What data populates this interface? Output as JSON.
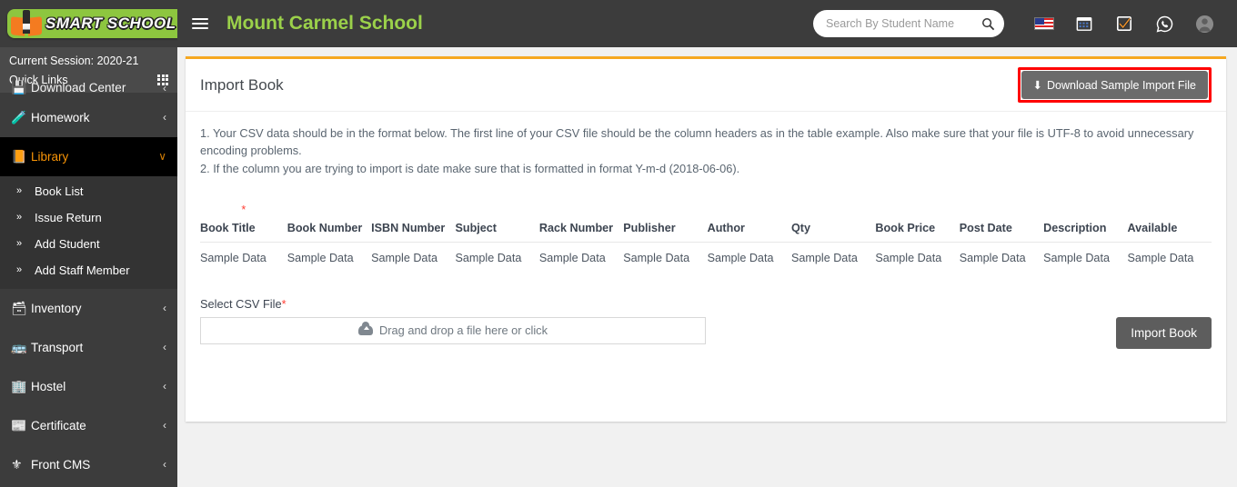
{
  "brand": {
    "logo_text": "SMART SCHOOL",
    "logo_bg": "#8dc63f",
    "accent": "#f89406"
  },
  "sidebar": {
    "session_label": "Current Session: 2020-21",
    "quick_links_label": "Quick Links",
    "clipped_item": {
      "label": "Download Center",
      "arrow": "‹",
      "icon": "download-center-icon"
    },
    "items": [
      {
        "label": "Homework",
        "icon": "🧪",
        "arrow": "‹",
        "active": false
      },
      {
        "label": "Library",
        "icon": "📙",
        "arrow": "∨",
        "active": true
      },
      {
        "label": "Inventory",
        "icon": "🗃",
        "arrow": "‹",
        "active": false
      },
      {
        "label": "Transport",
        "icon": "🚌",
        "arrow": "‹",
        "active": false
      },
      {
        "label": "Hostel",
        "icon": "🏢",
        "arrow": "‹",
        "active": false
      },
      {
        "label": "Certificate",
        "icon": "📰",
        "arrow": "‹",
        "active": false
      },
      {
        "label": "Front CMS",
        "icon": "⊕",
        "arrow": "‹",
        "active": false
      }
    ],
    "submenu": [
      {
        "label": "Book List"
      },
      {
        "label": "Issue Return"
      },
      {
        "label": "Add Student"
      },
      {
        "label": "Add Staff Member"
      }
    ],
    "sub_chevron": "»"
  },
  "header": {
    "school_title": "Mount Carmel School",
    "search_placeholder": "Search By Student Name",
    "search_value": "",
    "icons": [
      "flag-us-icon",
      "calendar-icon",
      "checkbox-icon",
      "whatsapp-icon",
      "avatar-icon"
    ]
  },
  "card": {
    "title": "Import Book",
    "download_button": "Download Sample Import File",
    "download_icon": "⬇",
    "highlight_color": "#ff0000",
    "notes": [
      "1. Your CSV data should be in the format below. The first line of your CSV file should be the column headers as in the table example. Also make sure that your file is UTF-8 to avoid unnecessary encoding problems.",
      "2. If the column you are trying to import is date make sure that is formatted in format Y-m-d (2018-06-06)."
    ]
  },
  "table": {
    "required_marker": "*",
    "headers": [
      "Book Title",
      "Book Number",
      "ISBN Number",
      "Subject",
      "Rack Number",
      "Publisher",
      "Author",
      "Qty",
      "Book Price",
      "Post Date",
      "Description",
      "Available"
    ],
    "required_header_index": 0,
    "rows": [
      [
        "Sample Data",
        "Sample Data",
        "Sample Data",
        "Sample Data",
        "Sample Data",
        "Sample Data",
        "Sample Data",
        "Sample Data",
        "Sample Data",
        "Sample Data",
        "Sample Data",
        "Sample Data"
      ]
    ]
  },
  "upload": {
    "label": "Select CSV File",
    "required_marker": "*",
    "dropzone_text": "Drag and drop a file here or click",
    "dropzone_icon": "cloud-upload-icon",
    "import_button": "Import Book"
  }
}
